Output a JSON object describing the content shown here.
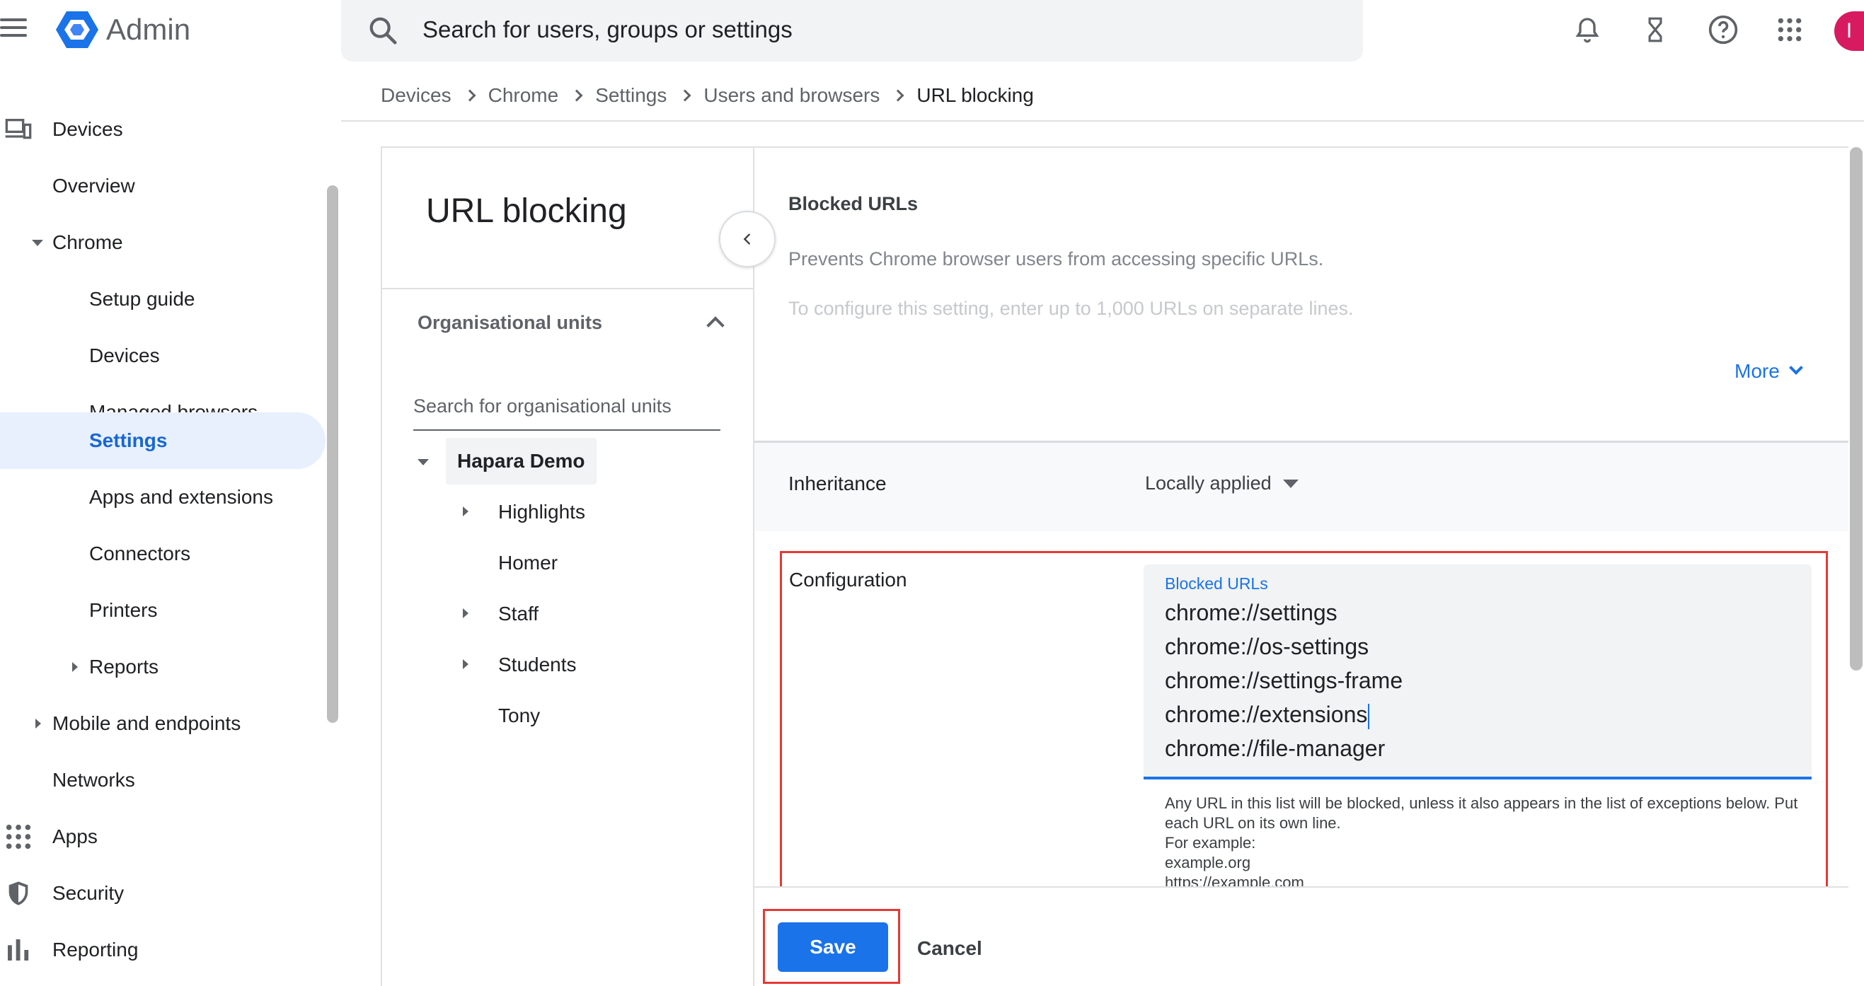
{
  "app": {
    "name": "Admin"
  },
  "search": {
    "placeholder": "Search for users, groups or settings"
  },
  "topbar_icons": [
    "bell-icon",
    "hourglass-icon",
    "help-icon",
    "apps-grid-icon"
  ],
  "avatar": {
    "initial": "I",
    "color": "#d81b60"
  },
  "nav": {
    "devices": "Devices",
    "overview": "Overview",
    "chrome": "Chrome",
    "setup_guide": "Setup guide",
    "chrome_devices": "Devices",
    "managed_browsers": "Managed browsers",
    "settings": "Settings",
    "apps_extensions": "Apps and extensions",
    "connectors": "Connectors",
    "printers": "Printers",
    "reports": "Reports",
    "mobile": "Mobile and endpoints",
    "networks": "Networks",
    "apps": "Apps",
    "security": "Security",
    "reporting": "Reporting"
  },
  "breadcrumb": [
    "Devices",
    "Chrome",
    "Settings",
    "Users and browsers",
    "URL blocking"
  ],
  "page": {
    "title": "URL blocking"
  },
  "ou": {
    "header": "Organisational units",
    "search_placeholder": "Search for organisational units",
    "root": "Hapara Demo",
    "children": [
      "Highlights",
      "Homer",
      "Staff",
      "Students",
      "Tony"
    ]
  },
  "setting": {
    "title": "Blocked URLs",
    "description": "Prevents Chrome browser users from accessing specific URLs.",
    "description2": "To configure this setting, enter up to 1,000 URLs on separate lines.",
    "more": "More"
  },
  "inheritance": {
    "label": "Inheritance",
    "value": "Locally applied"
  },
  "configuration": {
    "label": "Configuration",
    "field_label": "Blocked URLs",
    "urls": [
      "chrome://settings",
      "chrome://os-settings",
      "chrome://settings-frame",
      "chrome://extensions",
      "chrome://file-manager"
    ],
    "helper": [
      "Any URL in this list will be blocked, unless it also appears in the list of exceptions below. Put each URL on its own line.",
      "For example:",
      "example.org",
      "https://example.com"
    ]
  },
  "actions": {
    "save": "Save",
    "cancel": "Cancel"
  },
  "colors": {
    "accent": "#1a73e8",
    "highlight_border": "#e53935",
    "selected_bg": "#e8f0fe"
  }
}
